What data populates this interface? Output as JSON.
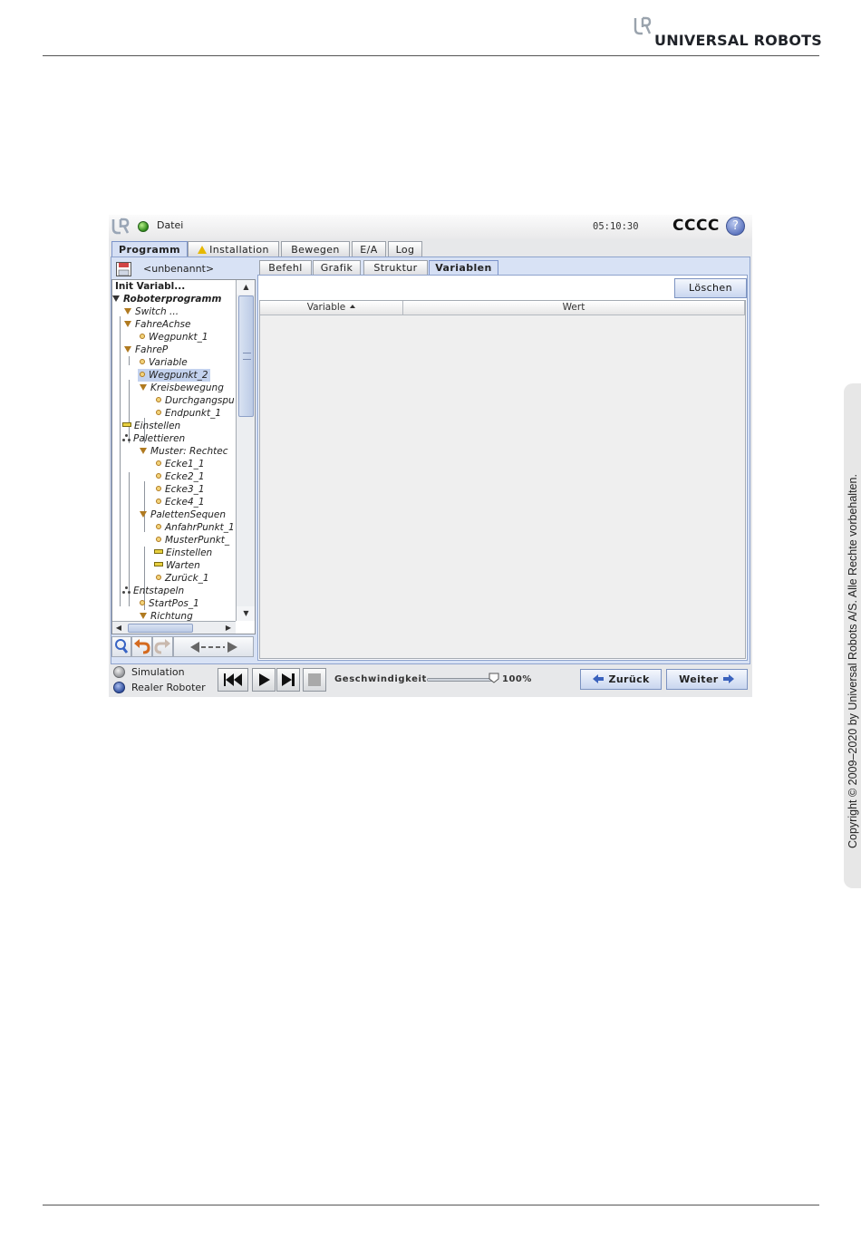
{
  "document": {
    "brand": "UNIVERSAL ROBOTS",
    "copyright": "Copyright © 2009–2020 by Universal Robots A/S. Alle Rechte vorbehalten."
  },
  "app": {
    "file_menu": "Datei",
    "clock": "05:10:30",
    "robot_name": "CCCC",
    "help_label": "?",
    "main_tabs": [
      {
        "label": "Programm",
        "active": true
      },
      {
        "label": "Installation",
        "warning": true
      },
      {
        "label": "Bewegen"
      },
      {
        "label": "E/A"
      },
      {
        "label": "Log"
      }
    ],
    "program_name": "<unbenannt>",
    "tree": [
      "Init Variabl...",
      "Roboterprogramm",
      "Switch ...",
      "FahreAchse",
      "Wegpunkt_1",
      "FahreP",
      "Variable",
      "Wegpunkt_2",
      "Kreisbewegung",
      "Durchgangspu",
      "Endpunkt_1",
      "Einstellen",
      "Palettieren",
      "Muster: Rechtec",
      "Ecke1_1",
      "Ecke2_1",
      "Ecke3_1",
      "Ecke4_1",
      "PalettenSequen",
      "AnfahrPunkt_1",
      "MusterPunkt_",
      "Einstellen",
      "Warten",
      "Zurück_1",
      "Entstapeln",
      "StartPos_1",
      "Richtung"
    ],
    "sub_tabs": [
      {
        "label": "Befehl"
      },
      {
        "label": "Grafik"
      },
      {
        "label": "Struktur"
      },
      {
        "label": "Variablen",
        "active": true
      }
    ],
    "clear_button": "Löschen",
    "table_headers": [
      "Variable",
      "Wert"
    ],
    "footer": {
      "simulation": "Simulation",
      "real_robot": "Realer Roboter",
      "speed_label": "Geschwindigkeit",
      "speed_value": "100%",
      "speed_fraction": 1.0,
      "back": "Zurück",
      "next": "Weiter"
    }
  }
}
